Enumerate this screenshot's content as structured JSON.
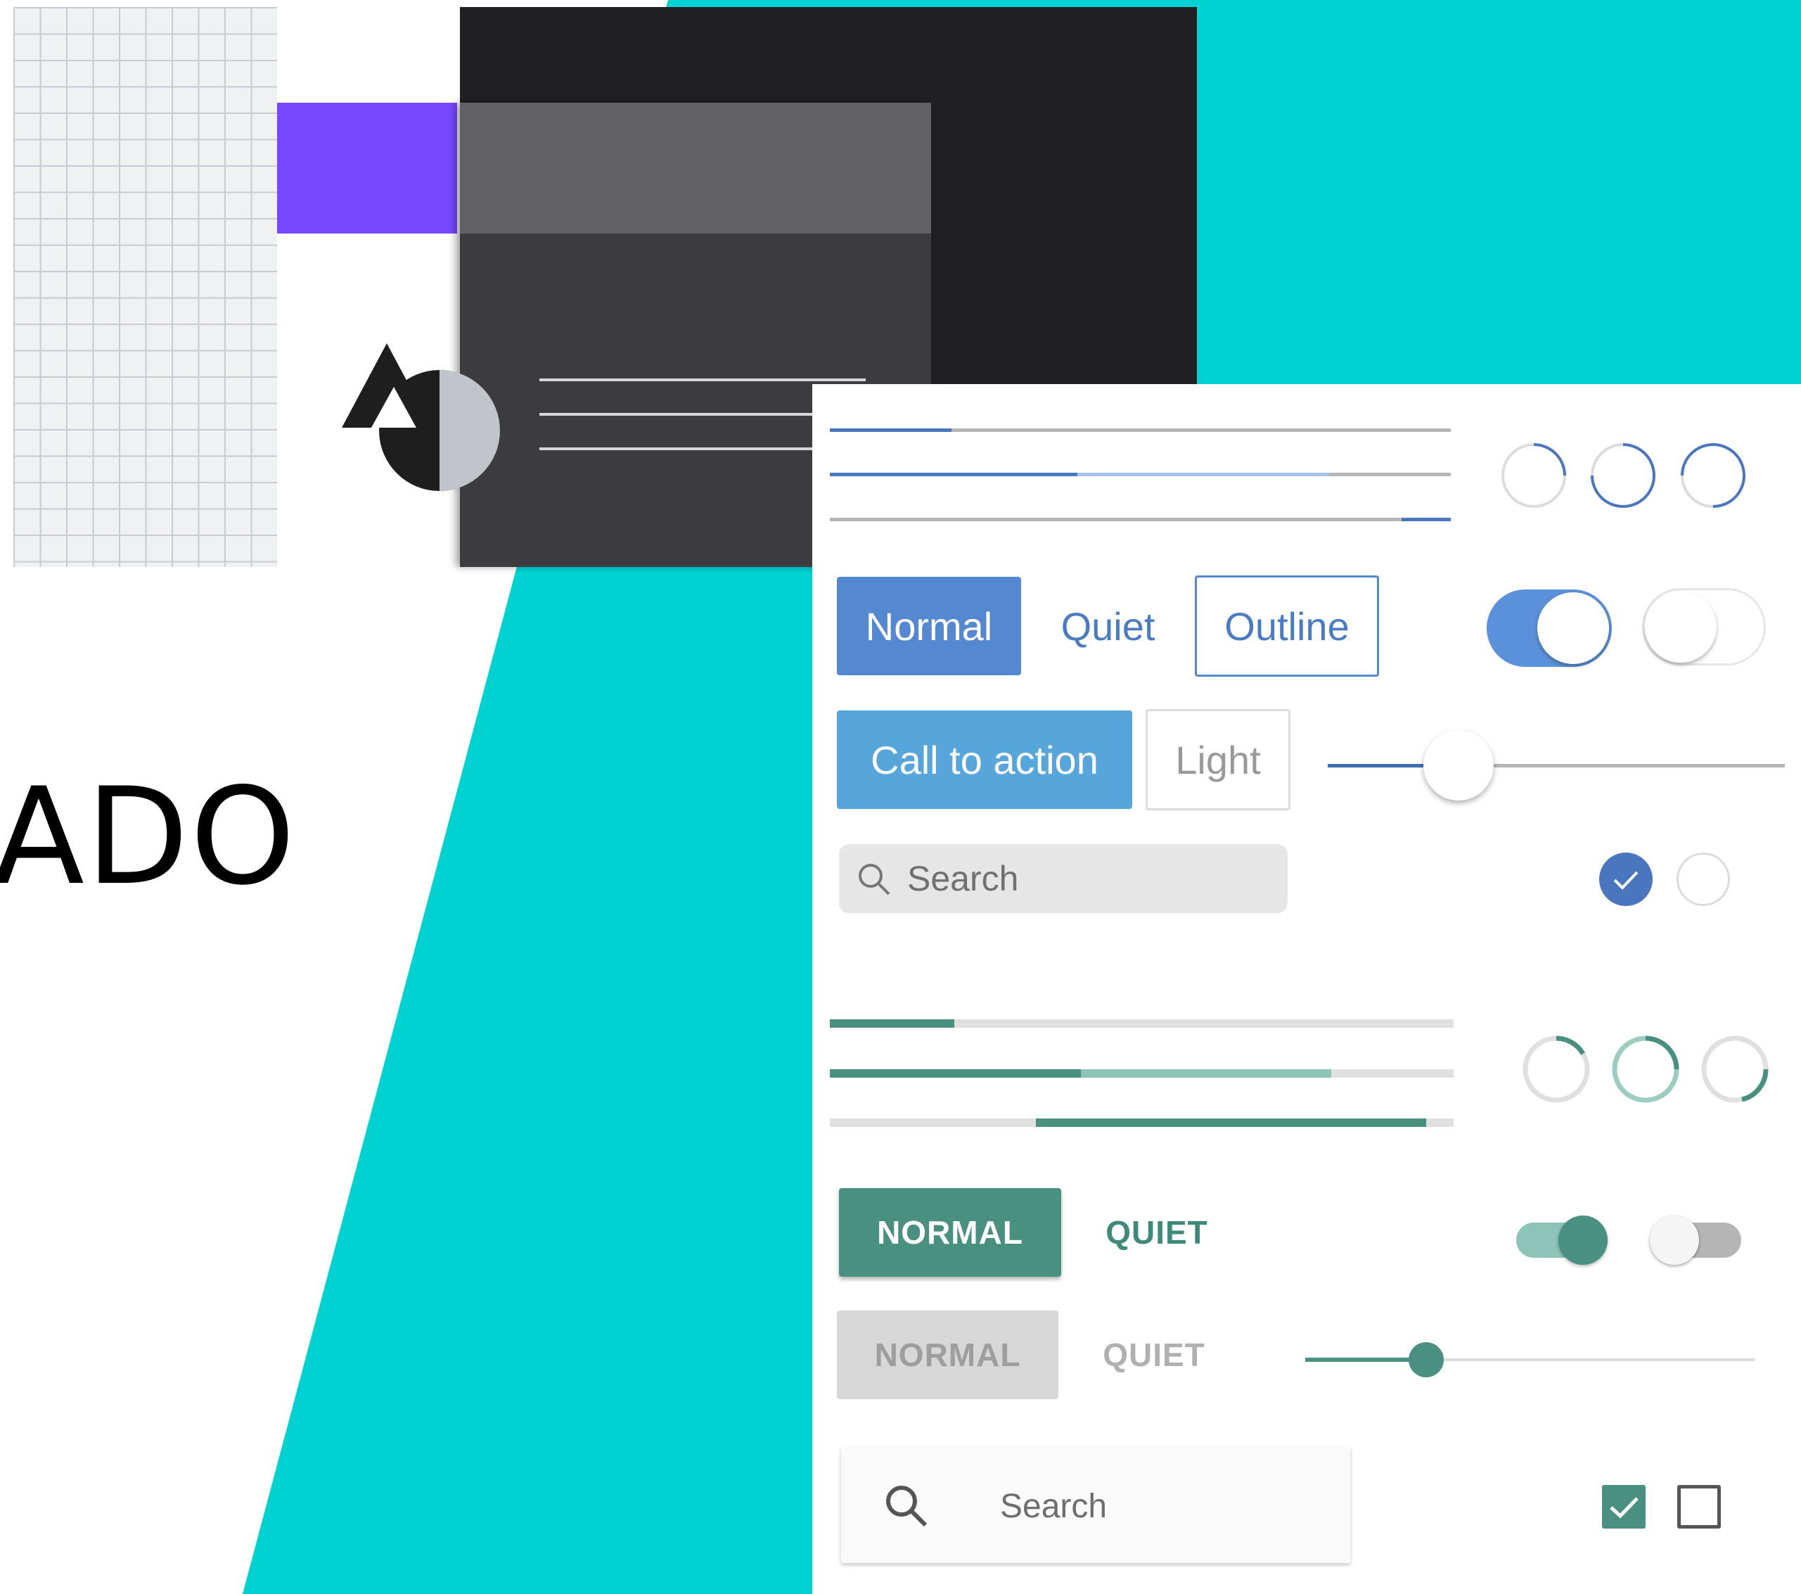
{
  "hero": {
    "partial_title": "ADO"
  },
  "colors": {
    "teal_bg": "#00d2d2",
    "purple": "#7748ff",
    "blue": "#5488d0",
    "blue_cta": "#56a6dc",
    "green": "#4a9080"
  },
  "ios_section": {
    "buttons": {
      "normal": "Normal",
      "quiet": "Quiet",
      "outline": "Outline",
      "call_to_action": "Call to action",
      "light": "Light"
    },
    "search": {
      "placeholder": "Search",
      "icon": "search-icon"
    },
    "progress_bars": [
      {
        "value": 0.2
      },
      {
        "value": 0.4,
        "buffer": 0.8
      },
      {
        "indeterminate": true
      }
    ],
    "toggles": [
      {
        "on": true
      },
      {
        "on": false
      }
    ],
    "slider": {
      "value": 0.28
    },
    "radios": [
      {
        "checked": true
      },
      {
        "checked": false
      }
    ]
  },
  "material_section": {
    "buttons": {
      "normal": "NORMAL",
      "quiet": "QUIET",
      "normal_disabled": "NORMAL",
      "quiet_disabled": "QUIET"
    },
    "search": {
      "placeholder": "Search",
      "icon": "search-icon"
    },
    "progress_bars": [
      {
        "value": 0.2
      },
      {
        "value": 0.4,
        "buffer": 0.8
      },
      {
        "indeterminate": true
      }
    ],
    "toggles": [
      {
        "on": true
      },
      {
        "on": false
      }
    ],
    "slider": {
      "value": 0.27
    },
    "checkboxes": [
      {
        "checked": true
      },
      {
        "checked": false
      }
    ]
  }
}
